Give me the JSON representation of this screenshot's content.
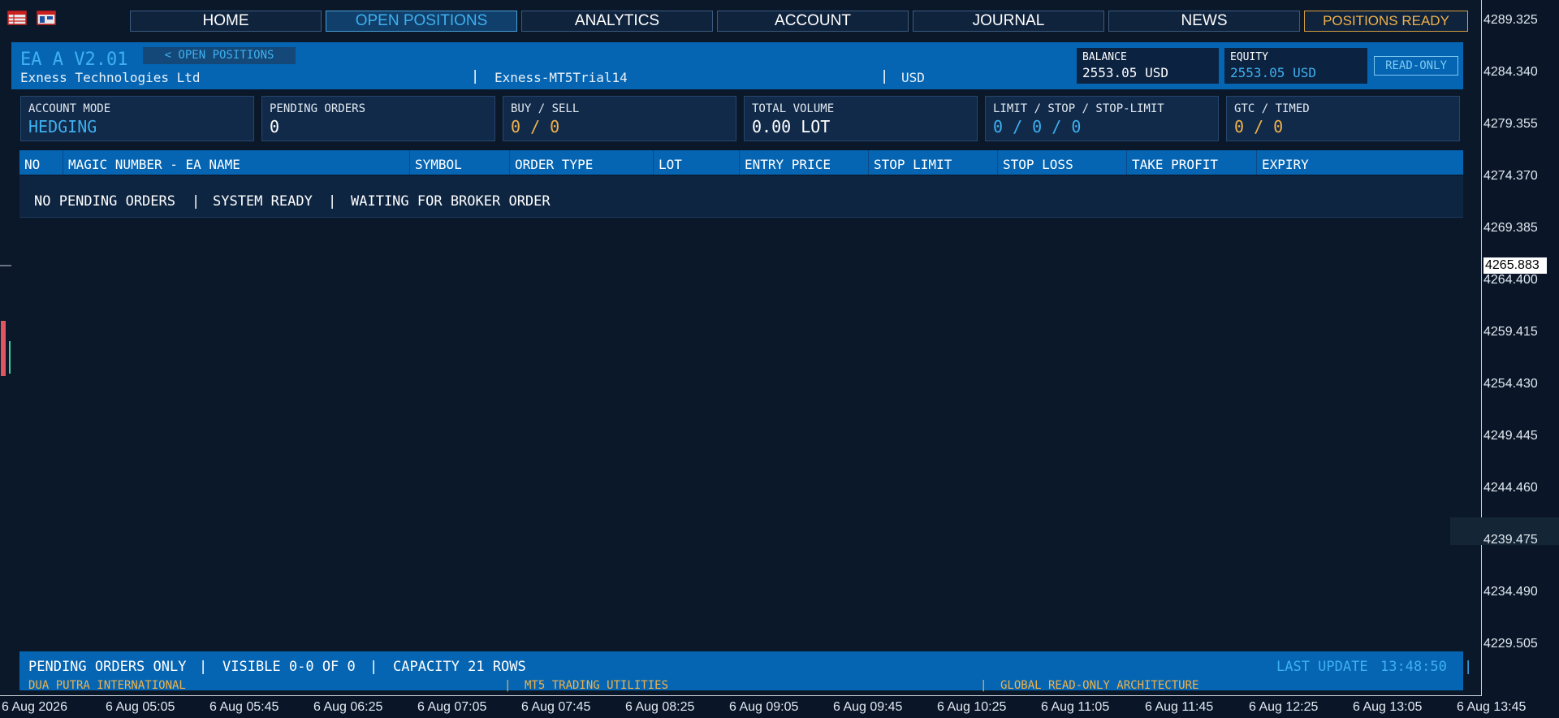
{
  "nav": {
    "home": "HOME",
    "open_positions": "OPEN POSITIONS",
    "analytics": "ANALYTICS",
    "account": "ACCOUNT",
    "journal": "JOURNAL",
    "news": "NEWS",
    "positions_ready": "POSITIONS READY"
  },
  "header": {
    "ea_title": "EA A V2.01",
    "back_label": "< OPEN POSITIONS",
    "company": "Exness Technologies Ltd",
    "server": "Exness-MT5Trial14",
    "currency": "USD",
    "separator": "|",
    "balance_label": "BALANCE",
    "balance_value": "2553.05 USD",
    "equity_label": "EQUITY",
    "equity_value": "2553.05 USD",
    "read_only": "READ-ONLY"
  },
  "stats": [
    {
      "label": "ACCOUNT MODE",
      "value": "HEDGING"
    },
    {
      "label": "PENDING ORDERS",
      "value": "0"
    },
    {
      "label": "BUY / SELL",
      "value": "0 / 0"
    },
    {
      "label": "TOTAL VOLUME",
      "value": "0.00 LOT"
    },
    {
      "label": "LIMIT / STOP / STOP-LIMIT",
      "value": "0 / 0 / 0"
    },
    {
      "label": "GTC / TIMED",
      "value": "0 / 0"
    }
  ],
  "table": {
    "columns": [
      "NO",
      "MAGIC NUMBER - EA NAME",
      "SYMBOL",
      "ORDER TYPE",
      "LOT",
      "ENTRY PRICE",
      "STOP LIMIT",
      "STOP LOSS",
      "TAKE PROFIT",
      "EXPIRY"
    ],
    "empty_message": [
      "NO PENDING ORDERS",
      "SYSTEM READY",
      "WAITING FOR BROKER ORDER"
    ]
  },
  "footer": {
    "status": [
      "PENDING ORDERS ONLY",
      "VISIBLE 0-0 OF 0",
      "CAPACITY 21 ROWS"
    ],
    "last_update_label": "LAST UPDATE",
    "last_update_time": "13:48:50",
    "credits": [
      "DUA PUTRA INTERNATIONAL",
      "MT5 TRADING UTILITIES",
      "GLOBAL READ-ONLY ARCHITECTURE"
    ]
  },
  "price_axis": [
    "4289.325",
    "4284.340",
    "4279.355",
    "4274.370",
    "4269.385",
    "4264.400",
    "4259.415",
    "4254.430",
    "4249.445",
    "4244.460",
    "4239.475",
    "4234.490",
    "4229.505"
  ],
  "current_price": "4265.883",
  "time_axis": [
    "6 Aug 2026",
    "6 Aug 05:05",
    "6 Aug 05:45",
    "6 Aug 06:25",
    "6 Aug 07:05",
    "6 Aug 07:45",
    "6 Aug 08:25",
    "6 Aug 09:05",
    "6 Aug 09:45",
    "6 Aug 10:25",
    "6 Aug 11:05",
    "6 Aug 11:45",
    "6 Aug 12:25",
    "6 Aug 13:05",
    "6 Aug 13:45"
  ],
  "colors": {
    "accent_blue": "#3fb0f0",
    "band_blue": "#0565b3",
    "orange": "#f0b24a",
    "background": "#0a1628"
  }
}
